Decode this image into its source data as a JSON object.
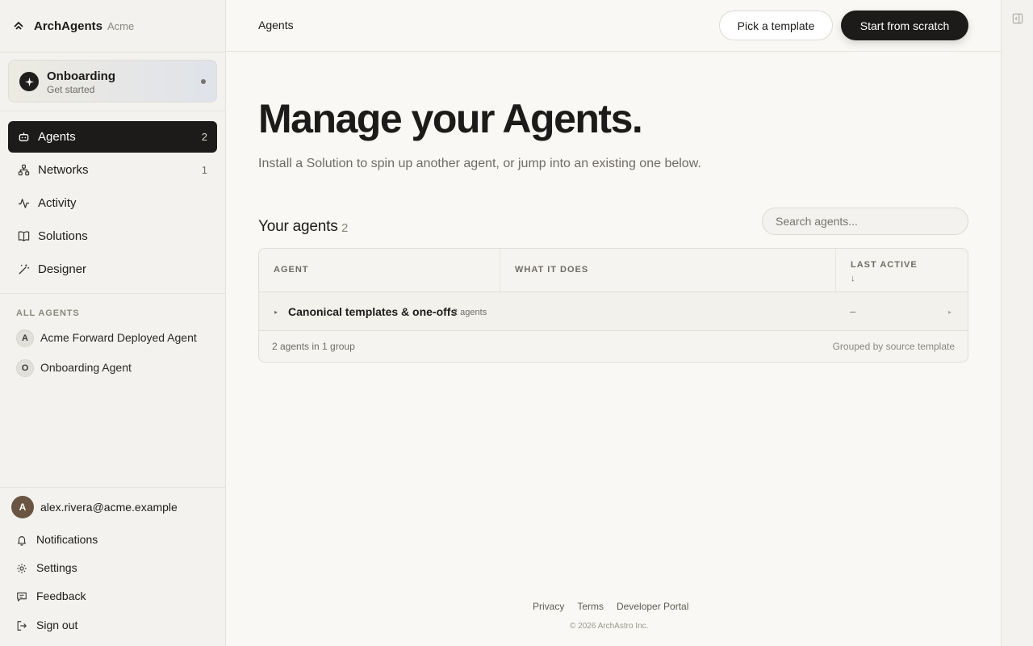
{
  "brand": {
    "name": "ArchAgents",
    "org": "Acme",
    "logo_icon": "chevron-up-logo"
  },
  "onboarding": {
    "title": "Onboarding",
    "subtitle": "Get started",
    "icon": "sparkle-icon"
  },
  "nav": {
    "items": [
      {
        "label": "Agents",
        "count": "2",
        "icon": "robot-icon",
        "active": true
      },
      {
        "label": "Networks",
        "count": "1",
        "icon": "network-icon",
        "active": false
      },
      {
        "label": "Activity",
        "count": "",
        "icon": "activity-icon",
        "active": false
      },
      {
        "label": "Solutions",
        "count": "",
        "icon": "book-icon",
        "active": false
      },
      {
        "label": "Designer",
        "count": "",
        "icon": "wand-icon",
        "active": false
      }
    ]
  },
  "all_agents": {
    "label": "ALL AGENTS",
    "items": [
      {
        "initial": "A",
        "name": "Acme Forward Deployed Agent"
      },
      {
        "initial": "O",
        "name": "Onboarding Agent"
      }
    ]
  },
  "user": {
    "initial": "A",
    "email": "alex.rivera@acme.example"
  },
  "footer_nav": [
    {
      "label": "Notifications",
      "icon": "bell-icon"
    },
    {
      "label": "Settings",
      "icon": "gear-icon"
    },
    {
      "label": "Feedback",
      "icon": "message-icon"
    },
    {
      "label": "Sign out",
      "icon": "sign-out-icon"
    }
  ],
  "topbar": {
    "title": "Agents",
    "pick_template_label": "Pick a template",
    "start_scratch_label": "Start from scratch"
  },
  "hero": {
    "title": "Manage your Agents.",
    "subtitle": "Install a Solution to spin up another agent, or jump into an existing one below."
  },
  "agents_list": {
    "title": "Your agents",
    "count": "2",
    "search_placeholder": "Search agents...",
    "columns": {
      "agent": "AGENT",
      "what": "WHAT IT DOES",
      "last_active": "LAST ACTIVE",
      "sort_arrow": "↓"
    },
    "group": {
      "name": "Canonical templates & one-offs",
      "count_label": "2 agents",
      "last_active": "–"
    },
    "footer_left": "2 agents in 1 group",
    "footer_right": "Grouped by source template"
  },
  "page_footer": {
    "links": [
      "Privacy",
      "Terms",
      "Developer Portal"
    ],
    "copyright": "© 2026 ArchAstro Inc."
  },
  "colors": {
    "accent": "#1c1b19",
    "background": "#f9f8f4",
    "sidebar": "#f3f2ee",
    "user_avatar": "#6a5543"
  }
}
